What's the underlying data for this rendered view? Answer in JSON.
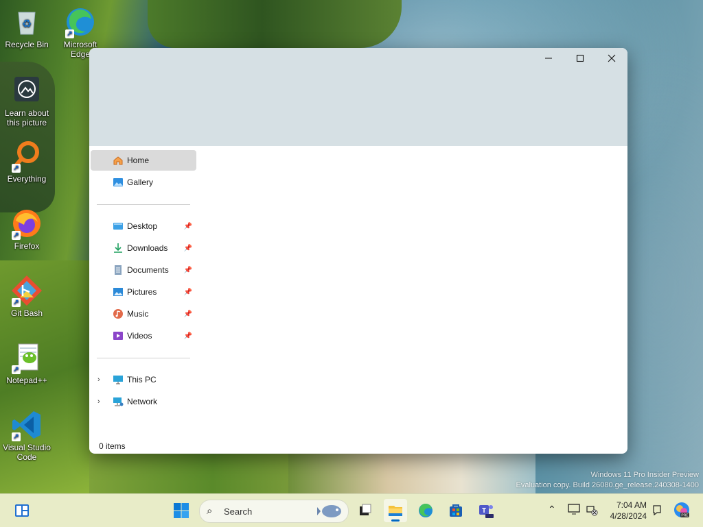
{
  "desktop": {
    "icons": [
      {
        "label": "Recycle Bin",
        "icon": "recycle-bin-icon"
      },
      {
        "label": "Microsoft Edge",
        "icon": "edge-icon"
      },
      {
        "label": "Learn about this picture",
        "icon": "camera-lens-icon"
      },
      {
        "label": "Everything",
        "icon": "everything-search-icon"
      },
      {
        "label": "Firefox",
        "icon": "firefox-icon"
      },
      {
        "label": "Git Bash",
        "icon": "git-bash-icon"
      },
      {
        "label": "Notepad++",
        "icon": "notepadpp-icon"
      },
      {
        "label": "Visual Studio Code",
        "icon": "vscode-icon"
      }
    ],
    "watermark": {
      "line1": "Windows 11 Pro Insider Preview",
      "line2": "Evaluation copy. Build 26080.ge_release.240308-1400"
    }
  },
  "explorer": {
    "window_controls": {
      "minimize": "—",
      "maximize": "☐",
      "close": "✕"
    },
    "nav_primary": [
      {
        "label": "Home",
        "icon": "home-icon",
        "selected": true
      },
      {
        "label": "Gallery",
        "icon": "gallery-icon",
        "selected": false
      }
    ],
    "quick_access": [
      {
        "label": "Desktop",
        "icon": "desktop-folder-icon",
        "pinned": true
      },
      {
        "label": "Downloads",
        "icon": "download-icon",
        "pinned": true
      },
      {
        "label": "Documents",
        "icon": "documents-icon",
        "pinned": true
      },
      {
        "label": "Pictures",
        "icon": "pictures-icon",
        "pinned": true
      },
      {
        "label": "Music",
        "icon": "music-icon",
        "pinned": true
      },
      {
        "label": "Videos",
        "icon": "videos-icon",
        "pinned": true
      }
    ],
    "locations": [
      {
        "label": "This PC",
        "icon": "this-pc-icon",
        "expandable": true
      },
      {
        "label": "Network",
        "icon": "network-icon",
        "expandable": true
      }
    ],
    "status": "0 items"
  },
  "taskbar": {
    "search_label": "Search",
    "clock": {
      "time": "7:04 AM",
      "date": "4/28/2024"
    },
    "apps": [
      "widgets-icon",
      "start-icon",
      "task-view-icon",
      "file-explorer-icon",
      "edge-icon",
      "store-icon",
      "teams-icon"
    ],
    "tray": [
      "chevron-up-icon",
      "display-icon",
      "network-disconnected-icon",
      "notification-icon",
      "copilot-icon"
    ],
    "accent": "#0067c0"
  }
}
